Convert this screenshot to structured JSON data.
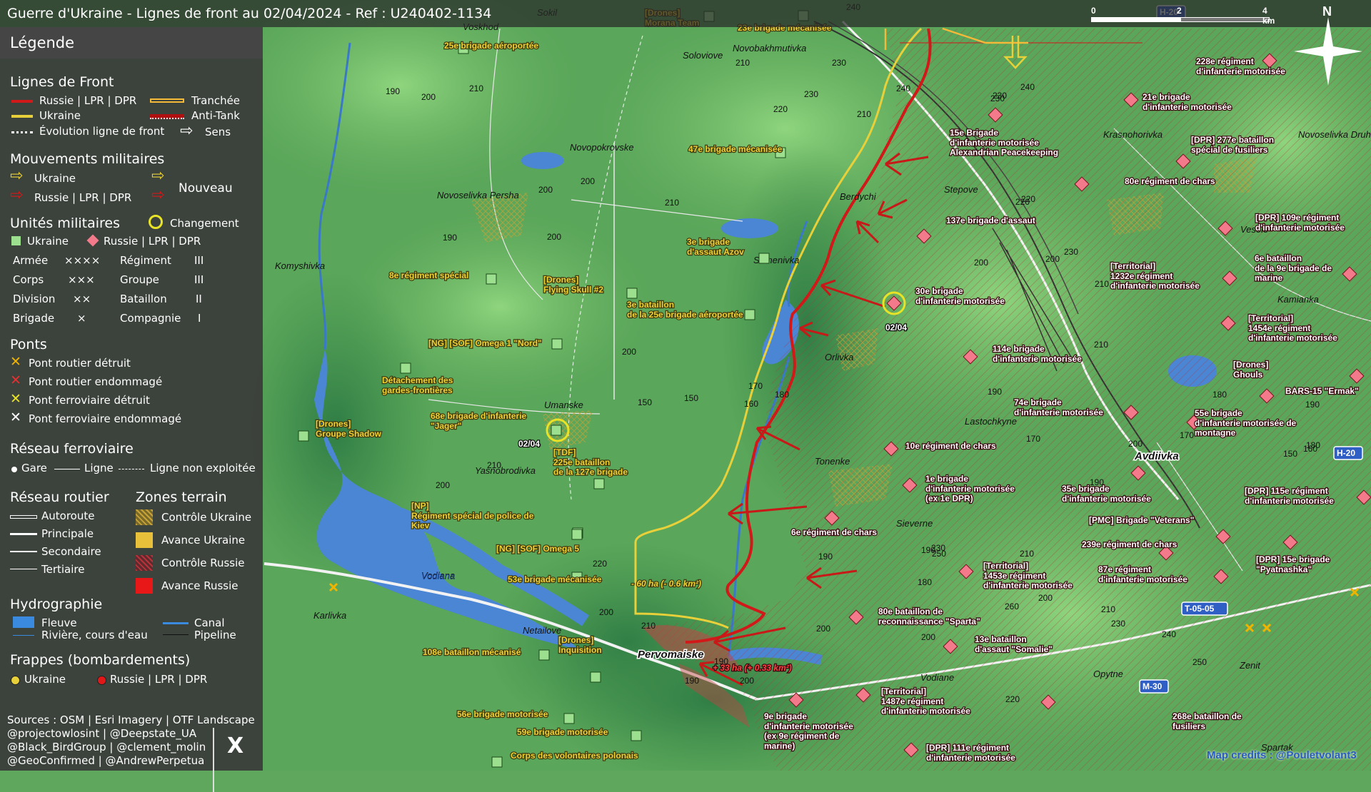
{
  "title": "Guerre d'Ukraine - Lignes de front au 02/04/2024 - Ref : U240402-1134",
  "legend": {
    "heading": "Légende",
    "sections": {
      "front": "Lignes de Front",
      "movements": "Mouvements militaires",
      "units": "Unités militaires",
      "bridges": "Ponts",
      "rail": "Réseau ferroviaire",
      "road": "Réseau routier",
      "zones": "Zones terrain",
      "hydro": "Hydrographie",
      "strikes": "Frappes (bombardements)"
    },
    "front_items": [
      "Russie | LPR | DPR",
      "Ukraine",
      "Évolution ligne de front",
      "Tranchée",
      "Anti-Tank",
      "Sens"
    ],
    "movement_items": [
      "Ukraine",
      "Russie | LPR | DPR",
      "Nouveau"
    ],
    "unit_items": [
      "Ukraine",
      "Russie | LPR | DPR",
      "Changement"
    ],
    "echelons": [
      {
        "name": "Armée",
        "sym": "××××"
      },
      {
        "name": "Corps",
        "sym": "×××"
      },
      {
        "name": "Division",
        "sym": "××"
      },
      {
        "name": "Brigade",
        "sym": "×"
      },
      {
        "name": "Régiment",
        "sym": "III"
      },
      {
        "name": "Groupe",
        "sym": "III"
      },
      {
        "name": "Bataillon",
        "sym": "II"
      },
      {
        "name": "Compagnie",
        "sym": "I"
      }
    ],
    "bridge_items": [
      "Pont routier détruit",
      "Pont routier endommagé",
      "Pont ferroviaire détruit",
      "Pont ferroviaire endommagé"
    ],
    "rail_items": [
      "Gare",
      "Ligne",
      "Ligne non exploitée"
    ],
    "road_items": [
      "Autoroute",
      "Principale",
      "Secondaire",
      "Tertiaire"
    ],
    "zone_items": [
      "Contrôle Ukraine",
      "Avance Ukraine",
      "Contrôle Russie",
      "Avance Russie"
    ],
    "hydro_items": [
      "Fleuve",
      "Canal",
      "Rivière, cours d'eau",
      "Pipeline"
    ],
    "strike_items": [
      "Ukraine",
      "Russie | LPR | DPR"
    ],
    "sources": [
      "Sources : OSM | Esri Imagery | OTF Landscape",
      "@projectowlosint | @Deepstate_UA",
      "@Black_BirdGroup | @clement_molin",
      "@GeoConfirmed | @AndrewPerpetua"
    ],
    "x_logo": "X"
  },
  "colors": {
    "russia": "#d21919",
    "ukraine": "#e8d03a",
    "trench": "#f5b93a",
    "water": "#4a86d4",
    "ukr_unit": "#9bdf8f",
    "rus_unit": "#f27a8a"
  },
  "scale": {
    "zero": "0",
    "two": "2",
    "four": "4 km"
  },
  "north": "N",
  "credits": "Map credits : @Pouletvolant3",
  "road_shields": [
    "H-20",
    "H-20",
    "T-05-05",
    "M-30"
  ],
  "places": [
    "Voskhod",
    "Sokil",
    "Soloviove",
    "Novobakhmutivka",
    "Novopokrovske",
    "Novoselivka Persha",
    "Berdychi",
    "Stepove",
    "Krasnohorivka",
    "Novoselivka Druha",
    "Veselе",
    "Komyshivka",
    "Semenivka",
    "Kamianka",
    "Orlivka",
    "Umanske",
    "Lastochkyne",
    "Avdiivka",
    "Tonenke",
    "Yasnobrodivka",
    "Sievernе",
    "Vodiana",
    "Karlivka",
    "Netailove",
    "Pervomaiske",
    "Vodiane",
    "Opytne",
    "Zenit",
    "Spartak"
  ],
  "places_display": [
    "Voskhod",
    "Sokil",
    "Soloviove",
    "Novobakhmutivka",
    "Novopokrovske",
    "Novoselivka Persha",
    "Berdychi",
    "Stepove",
    "Krasnohorivka",
    "Novoselivka Druha",
    "Vesele",
    "Komyshivka",
    "Semenivka",
    "Kamianka",
    "Orlivka",
    "Umanske",
    "Lastochkyne",
    "Avdiivka",
    "Tonenke",
    "Yasnobrodivka",
    "Sieverne",
    "Vodiana",
    "Karlivka",
    "Netailove",
    "Pervomaiske",
    "Vodiane",
    "Opytne",
    "Zenit",
    "Spartak"
  ],
  "ukr_units": [
    "[Drones]\nMorana Team",
    "23e brigade mécanisée",
    "25e brigade aéroportée",
    "47e brigade mécanisée",
    "3e brigade\nd'assaut Azov",
    "8e régiment spécial",
    "[Drones]\nFlying Skull #2",
    "3e bataillon\nde la 25e brigade aéroportée",
    "[NG] [SOF] Omega 1 \"Nord\"",
    "Détachement des\ngardes-frontières",
    "68e brigade d'infanterie\n\"Jager\"",
    "[Drones]\nGroupe Shadow",
    "[TDF]\n225e bataillon\nde la 127e brigade",
    "[NP]\nRégiment spécial de police de\nKiev",
    "[NG] [SOF] Omega 5",
    "53e brigade mécanisée",
    "[Drones]\nInquisition",
    "108e bataillon mécanisé",
    "56e brigade motorisée",
    "59e brigade motorisée",
    "Corps des volontaires polonais"
  ],
  "rus_units": [
    "228e régiment\nd'infanterie motorisée",
    "21e brigade\nd'infanterie motorisée",
    "15e Brigade\nd'infanterie motorisée\nAlexandrian Peacekeeping",
    "[DPR] 277e bataillon\nspécial de fusiliers",
    "80e régiment de chars",
    "137e brigade d'assaut",
    "[DPR] 109e régiment\nd'infanterie motorisée",
    "[Territorial]\n1232e régiment\nd'infanterie motorisée",
    "6e bataillon\nde la 9e brigade de\nmarine",
    "30e brigade\nd'infanterie motorisée",
    "[Territorial]\n1454e régiment\nd'infanterie motorisée",
    "114e brigade\nd'infanterie motorisée",
    "[Drones]\nGhouls",
    "BARS-15 \"Ermak\"",
    "74e brigade\nd'infanterie motorisée",
    "55e brigade\nd'infanterie motorisée de\nmontagne",
    "10e régiment de chars",
    "1e brigade\nd'infanterie motorisée\n(ex 1e DPR)",
    "35e brigade\nd'infanterie motorisée",
    "[DPR] 115e régiment\nd'infanterie motorisée",
    "6e régiment de chars",
    "[PMC] Brigade \"Veterans\"",
    "239e régiment de chars",
    "[Territorial]\n1453e régiment\nd'infanterie motorisée",
    "87e régiment\nd'infanterie motorisée",
    "[DPR] 15e brigade\n\"Pyatnashka\"",
    "80e bataillon de\nreconnaissance \"Sparta\"",
    "13e bataillon\nd'assaut \"Somalie\"",
    "[Territorial]\n1487e régiment\nd'infanterie motorisée",
    "268e bataillon de\nfusiliers",
    "9e brigade\nd'infanterie motorisée\n(ex 9e régiment de\nmarine)",
    "[DPR] 111e régiment\nd'infanterie motorisée"
  ],
  "change_dates": [
    "02/04",
    "02/04"
  ],
  "area_changes": [
    "- 60 ha (- 0.6 km²)",
    "+ 33 ha (+ 0.33 km²)"
  ],
  "elevations": [
    "240",
    "230",
    "240",
    "230",
    "210",
    "190",
    "200",
    "210",
    "230",
    "220",
    "240",
    "220",
    "210",
    "200",
    "210",
    "230",
    "230",
    "210",
    "200",
    "220",
    "200",
    "210",
    "190",
    "200",
    "200",
    "210",
    "170",
    "160",
    "180",
    "150",
    "200",
    "150",
    "190",
    "170",
    "190",
    "200",
    "160",
    "150",
    "180",
    "170",
    "180",
    "190",
    "200",
    "210",
    "220",
    "200",
    "210",
    "190",
    "190",
    "200",
    "200",
    "190",
    "180",
    "190",
    "200",
    "230",
    "250",
    "260",
    "220",
    "210",
    "200",
    "210",
    "230",
    "240",
    "250"
  ],
  "river_label": "Vodiana"
}
